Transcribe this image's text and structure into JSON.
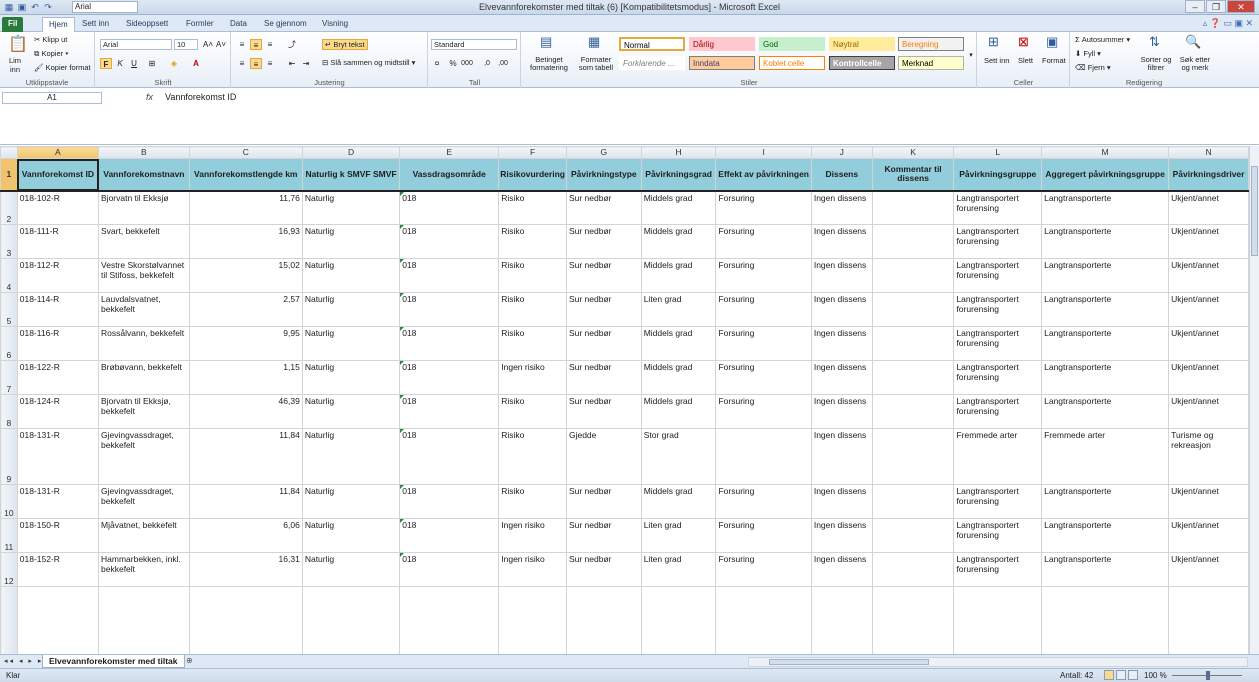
{
  "window": {
    "title": "Elvevannforekomster med tiltak (6)  [Kompatibilitetsmodus]  -  Microsoft Excel",
    "qat_font": "Arial",
    "buttons": [
      "–",
      "❐",
      "✕"
    ]
  },
  "tabs": [
    {
      "label": "Fil"
    },
    {
      "label": "Hjem"
    },
    {
      "label": "Sett inn"
    },
    {
      "label": "Sideoppsett"
    },
    {
      "label": "Formler"
    },
    {
      "label": "Data"
    },
    {
      "label": "Se gjennom"
    },
    {
      "label": "Visning"
    }
  ],
  "ribbon": {
    "clipboard": {
      "label": "Utklippstavle",
      "paste": "Lim inn",
      "cut": "Klipp ut",
      "copy": "Kopier",
      "format_painter": "Kopier format"
    },
    "font": {
      "label": "Skrift",
      "name": "Arial",
      "size": "10"
    },
    "alignment": {
      "label": "Justering",
      "wrap": "Bryt tekst",
      "merge": "Slå sammen og midtstill"
    },
    "number": {
      "label": "Tall",
      "format": "Standard"
    },
    "styles": {
      "label": "Stiler",
      "cond_format": "Betinget formatering",
      "format_table": "Formater som tabell",
      "cells": [
        {
          "text": "Normal",
          "bg": "#ffffff",
          "color": "#000000",
          "border": "#e5a83b"
        },
        {
          "text": "Dårlig",
          "bg": "#ffc7ce",
          "color": "#9c0006",
          "border": "#ffc7ce"
        },
        {
          "text": "God",
          "bg": "#c6efce",
          "color": "#006100",
          "border": "#c6efce"
        },
        {
          "text": "Nøytral",
          "bg": "#ffeb9c",
          "color": "#9c6500",
          "border": "#ffeb9c"
        },
        {
          "text": "Beregning",
          "bg": "#f2f2f2",
          "color": "#fa7d00",
          "border": "#7f7f7f"
        },
        {
          "text": "Forklarende ...",
          "bg": "#ffffff",
          "color": "#7f7f7f",
          "border": "#ffffff"
        },
        {
          "text": "Inndata",
          "bg": "#ffcc99",
          "color": "#3f3f76",
          "border": "#7f7f7f"
        },
        {
          "text": "Koblet celle",
          "bg": "#ffffff",
          "color": "#fa7d00",
          "border": "#ff8001"
        },
        {
          "text": "Kontrollcelle",
          "bg": "#a5a5a5",
          "color": "#ffffff",
          "border": "#3f3f3f"
        },
        {
          "text": "Merknad",
          "bg": "#ffffcc",
          "color": "#000000",
          "border": "#b2b2b2"
        }
      ]
    },
    "cells": {
      "label": "Celler",
      "insert": "Sett inn",
      "delete": "Slett",
      "format": "Format"
    },
    "editing": {
      "label": "Redigering",
      "autosum": "Autosummer",
      "fill": "Fyll",
      "clear": "Fjern",
      "sort": "Sorter og filtrer",
      "find": "Søk etter og merk"
    }
  },
  "formula_bar": {
    "name_box": "A1",
    "fx": "fx",
    "formula": "Vannforekomst ID"
  },
  "columns": [
    "A",
    "B",
    "C",
    "D",
    "E",
    "F",
    "G",
    "H",
    "I",
    "J",
    "K",
    "L",
    "M",
    "N"
  ],
  "headers": [
    "Vannforekomst ID",
    "Vannforekomstnavn",
    "Vannforekomstlengde km",
    "Naturlig k SMVF  SMVF",
    "Vassdragsområde",
    "Risikovurdering",
    "Påvirkningstype",
    "Påvirkningsgrad",
    "Effekt av påvirkningen",
    "Dissens",
    "Kommentar til dissens",
    "Påvirkningsgruppe",
    "Aggregert påvirkningsgruppe",
    "Påvirkningsdriver"
  ],
  "rows": [
    {
      "n": "2",
      "cells": [
        "018-102-R",
        "Bjorvatn til Ekksjø",
        "11,76",
        "Naturlig",
        "018",
        "Risiko",
        "Sur nedbør",
        "Middels grad",
        "Forsuring",
        "Ingen dissens",
        "",
        "Langtransportert forurensing",
        "Langtransporterte",
        "Ukjent/annet"
      ]
    },
    {
      "n": "3",
      "cells": [
        "018-111-R",
        "Svart, bekkefelt",
        "16,93",
        "Naturlig",
        "018",
        "Risiko",
        "Sur nedbør",
        "Middels grad",
        "Forsuring",
        "Ingen dissens",
        "",
        "Langtransportert forurensing",
        "Langtransporterte",
        "Ukjent/annet"
      ]
    },
    {
      "n": "4",
      "cells": [
        "018-112-R",
        "Vestre Skorstølvannet til Stifoss, bekkefelt",
        "15,02",
        "Naturlig",
        "018",
        "Risiko",
        "Sur nedbør",
        "Middels grad",
        "Forsuring",
        "Ingen dissens",
        "",
        "Langtransportert forurensing",
        "Langtransporterte",
        "Ukjent/annet"
      ]
    },
    {
      "n": "5",
      "cells": [
        "018-114-R",
        "Lauvdalsvatnet, bekkefelt",
        "2,57",
        "Naturlig",
        "018",
        "Risiko",
        "Sur nedbør",
        "Liten grad",
        "Forsuring",
        "Ingen dissens",
        "",
        "Langtransportert forurensing",
        "Langtransporterte",
        "Ukjent/annet"
      ]
    },
    {
      "n": "6",
      "cells": [
        "018-116-R",
        "Rossålvann, bekkefelt",
        "9,95",
        "Naturlig",
        "018",
        "Risiko",
        "Sur nedbør",
        "Middels grad",
        "Forsuring",
        "Ingen dissens",
        "",
        "Langtransportert forurensing",
        "Langtransporterte",
        "Ukjent/annet"
      ]
    },
    {
      "n": "7",
      "cells": [
        "018-122-R",
        "Brøbøvann, bekkefelt",
        "1,15",
        "Naturlig",
        "018",
        "Ingen risiko",
        "Sur nedbør",
        "Middels grad",
        "Forsuring",
        "Ingen dissens",
        "",
        "Langtransportert forurensing",
        "Langtransporterte",
        "Ukjent/annet"
      ]
    },
    {
      "n": "8",
      "cells": [
        "018-124-R",
        "Bjorvatn til Ekksjø, bekkefelt",
        "46,39",
        "Naturlig",
        "018",
        "Risiko",
        "Sur nedbør",
        "Middels grad",
        "Forsuring",
        "Ingen dissens",
        "",
        "Langtransportert forurensing",
        "Langtransporterte",
        "Ukjent/annet"
      ]
    },
    {
      "n": "9",
      "cells": [
        "018-131-R",
        "Gjevingvassdraget, bekkefelt",
        "11,84",
        "Naturlig",
        "018",
        "Risiko",
        "Gjedde",
        "Stor grad",
        "",
        "Ingen dissens",
        "",
        "Fremmede arter",
        "Fremmede arter",
        "Turisme og rekreasjon"
      ]
    },
    {
      "n": "10",
      "cells": [
        "018-131-R",
        "Gjevingvassdraget, bekkefelt",
        "11,84",
        "Naturlig",
        "018",
        "Risiko",
        "Sur nedbør",
        "Middels grad",
        "Forsuring",
        "Ingen dissens",
        "",
        "Langtransportert forurensing",
        "Langtransporterte",
        "Ukjent/annet"
      ]
    },
    {
      "n": "11",
      "cells": [
        "018-150-R",
        "Mjåvatnet, bekkefelt",
        "6,06",
        "Naturlig",
        "018",
        "Ingen risiko",
        "Sur nedbør",
        "Liten grad",
        "Forsuring",
        "Ingen dissens",
        "",
        "Langtransportert forurensing",
        "Langtransporterte",
        "Ukjent/annet"
      ]
    },
    {
      "n": "12",
      "cells": [
        "018-152-R",
        "Hammarbekken, inkl. bekkefelt",
        "16,31",
        "Naturlig",
        "018",
        "Ingen risiko",
        "Sur nedbør",
        "Liten grad",
        "Forsuring",
        "Ingen dissens",
        "",
        "Langtransportert forurensing",
        "Langtransporterte",
        "Ukjent/annet"
      ]
    }
  ],
  "sheet_tab": "Elvevannforekomster med tiltak",
  "status": {
    "ready": "Klar",
    "count": "Antall: 42",
    "zoom": "100 %"
  }
}
